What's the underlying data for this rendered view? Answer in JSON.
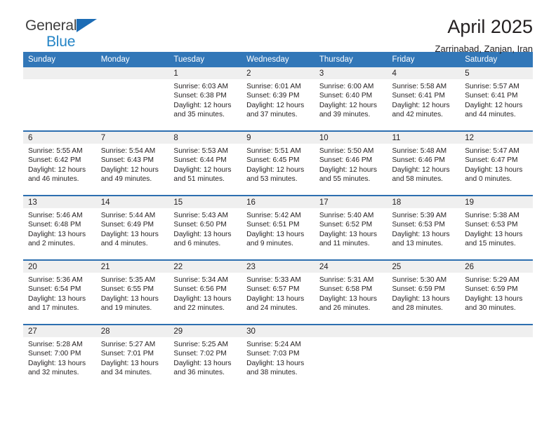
{
  "brand": {
    "name_top": "General",
    "name_bottom": "Blue",
    "accent_color": "#2484c6",
    "triangle_color": "#1c6cb5"
  },
  "header": {
    "title": "April 2025",
    "subtitle": "Zarrinabad, Zanjan, Iran"
  },
  "calendar": {
    "header_bg": "#3277b8",
    "daynum_bg": "#efefef",
    "row_border_color": "#2d6fb0",
    "weekday_headers": [
      "Sunday",
      "Monday",
      "Tuesday",
      "Wednesday",
      "Thursday",
      "Friday",
      "Saturday"
    ],
    "labels": {
      "sunrise": "Sunrise:",
      "sunset": "Sunset:",
      "daylight": "Daylight:"
    },
    "weeks": [
      [
        {
          "day": "",
          "sunrise": "",
          "sunset": "",
          "daylight": ""
        },
        {
          "day": "",
          "sunrise": "",
          "sunset": "",
          "daylight": ""
        },
        {
          "day": "1",
          "sunrise": "Sunrise: 6:03 AM",
          "sunset": "Sunset: 6:38 PM",
          "daylight": "Daylight: 12 hours and 35 minutes."
        },
        {
          "day": "2",
          "sunrise": "Sunrise: 6:01 AM",
          "sunset": "Sunset: 6:39 PM",
          "daylight": "Daylight: 12 hours and 37 minutes."
        },
        {
          "day": "3",
          "sunrise": "Sunrise: 6:00 AM",
          "sunset": "Sunset: 6:40 PM",
          "daylight": "Daylight: 12 hours and 39 minutes."
        },
        {
          "day": "4",
          "sunrise": "Sunrise: 5:58 AM",
          "sunset": "Sunset: 6:41 PM",
          "daylight": "Daylight: 12 hours and 42 minutes."
        },
        {
          "day": "5",
          "sunrise": "Sunrise: 5:57 AM",
          "sunset": "Sunset: 6:41 PM",
          "daylight": "Daylight: 12 hours and 44 minutes."
        }
      ],
      [
        {
          "day": "6",
          "sunrise": "Sunrise: 5:55 AM",
          "sunset": "Sunset: 6:42 PM",
          "daylight": "Daylight: 12 hours and 46 minutes."
        },
        {
          "day": "7",
          "sunrise": "Sunrise: 5:54 AM",
          "sunset": "Sunset: 6:43 PM",
          "daylight": "Daylight: 12 hours and 49 minutes."
        },
        {
          "day": "8",
          "sunrise": "Sunrise: 5:53 AM",
          "sunset": "Sunset: 6:44 PM",
          "daylight": "Daylight: 12 hours and 51 minutes."
        },
        {
          "day": "9",
          "sunrise": "Sunrise: 5:51 AM",
          "sunset": "Sunset: 6:45 PM",
          "daylight": "Daylight: 12 hours and 53 minutes."
        },
        {
          "day": "10",
          "sunrise": "Sunrise: 5:50 AM",
          "sunset": "Sunset: 6:46 PM",
          "daylight": "Daylight: 12 hours and 55 minutes."
        },
        {
          "day": "11",
          "sunrise": "Sunrise: 5:48 AM",
          "sunset": "Sunset: 6:46 PM",
          "daylight": "Daylight: 12 hours and 58 minutes."
        },
        {
          "day": "12",
          "sunrise": "Sunrise: 5:47 AM",
          "sunset": "Sunset: 6:47 PM",
          "daylight": "Daylight: 13 hours and 0 minutes."
        }
      ],
      [
        {
          "day": "13",
          "sunrise": "Sunrise: 5:46 AM",
          "sunset": "Sunset: 6:48 PM",
          "daylight": "Daylight: 13 hours and 2 minutes."
        },
        {
          "day": "14",
          "sunrise": "Sunrise: 5:44 AM",
          "sunset": "Sunset: 6:49 PM",
          "daylight": "Daylight: 13 hours and 4 minutes."
        },
        {
          "day": "15",
          "sunrise": "Sunrise: 5:43 AM",
          "sunset": "Sunset: 6:50 PM",
          "daylight": "Daylight: 13 hours and 6 minutes."
        },
        {
          "day": "16",
          "sunrise": "Sunrise: 5:42 AM",
          "sunset": "Sunset: 6:51 PM",
          "daylight": "Daylight: 13 hours and 9 minutes."
        },
        {
          "day": "17",
          "sunrise": "Sunrise: 5:40 AM",
          "sunset": "Sunset: 6:52 PM",
          "daylight": "Daylight: 13 hours and 11 minutes."
        },
        {
          "day": "18",
          "sunrise": "Sunrise: 5:39 AM",
          "sunset": "Sunset: 6:53 PM",
          "daylight": "Daylight: 13 hours and 13 minutes."
        },
        {
          "day": "19",
          "sunrise": "Sunrise: 5:38 AM",
          "sunset": "Sunset: 6:53 PM",
          "daylight": "Daylight: 13 hours and 15 minutes."
        }
      ],
      [
        {
          "day": "20",
          "sunrise": "Sunrise: 5:36 AM",
          "sunset": "Sunset: 6:54 PM",
          "daylight": "Daylight: 13 hours and 17 minutes."
        },
        {
          "day": "21",
          "sunrise": "Sunrise: 5:35 AM",
          "sunset": "Sunset: 6:55 PM",
          "daylight": "Daylight: 13 hours and 19 minutes."
        },
        {
          "day": "22",
          "sunrise": "Sunrise: 5:34 AM",
          "sunset": "Sunset: 6:56 PM",
          "daylight": "Daylight: 13 hours and 22 minutes."
        },
        {
          "day": "23",
          "sunrise": "Sunrise: 5:33 AM",
          "sunset": "Sunset: 6:57 PM",
          "daylight": "Daylight: 13 hours and 24 minutes."
        },
        {
          "day": "24",
          "sunrise": "Sunrise: 5:31 AM",
          "sunset": "Sunset: 6:58 PM",
          "daylight": "Daylight: 13 hours and 26 minutes."
        },
        {
          "day": "25",
          "sunrise": "Sunrise: 5:30 AM",
          "sunset": "Sunset: 6:59 PM",
          "daylight": "Daylight: 13 hours and 28 minutes."
        },
        {
          "day": "26",
          "sunrise": "Sunrise: 5:29 AM",
          "sunset": "Sunset: 6:59 PM",
          "daylight": "Daylight: 13 hours and 30 minutes."
        }
      ],
      [
        {
          "day": "27",
          "sunrise": "Sunrise: 5:28 AM",
          "sunset": "Sunset: 7:00 PM",
          "daylight": "Daylight: 13 hours and 32 minutes."
        },
        {
          "day": "28",
          "sunrise": "Sunrise: 5:27 AM",
          "sunset": "Sunset: 7:01 PM",
          "daylight": "Daylight: 13 hours and 34 minutes."
        },
        {
          "day": "29",
          "sunrise": "Sunrise: 5:25 AM",
          "sunset": "Sunset: 7:02 PM",
          "daylight": "Daylight: 13 hours and 36 minutes."
        },
        {
          "day": "30",
          "sunrise": "Sunrise: 5:24 AM",
          "sunset": "Sunset: 7:03 PM",
          "daylight": "Daylight: 13 hours and 38 minutes."
        },
        {
          "day": "",
          "sunrise": "",
          "sunset": "",
          "daylight": ""
        },
        {
          "day": "",
          "sunrise": "",
          "sunset": "",
          "daylight": ""
        },
        {
          "day": "",
          "sunrise": "",
          "sunset": "",
          "daylight": ""
        }
      ]
    ]
  }
}
